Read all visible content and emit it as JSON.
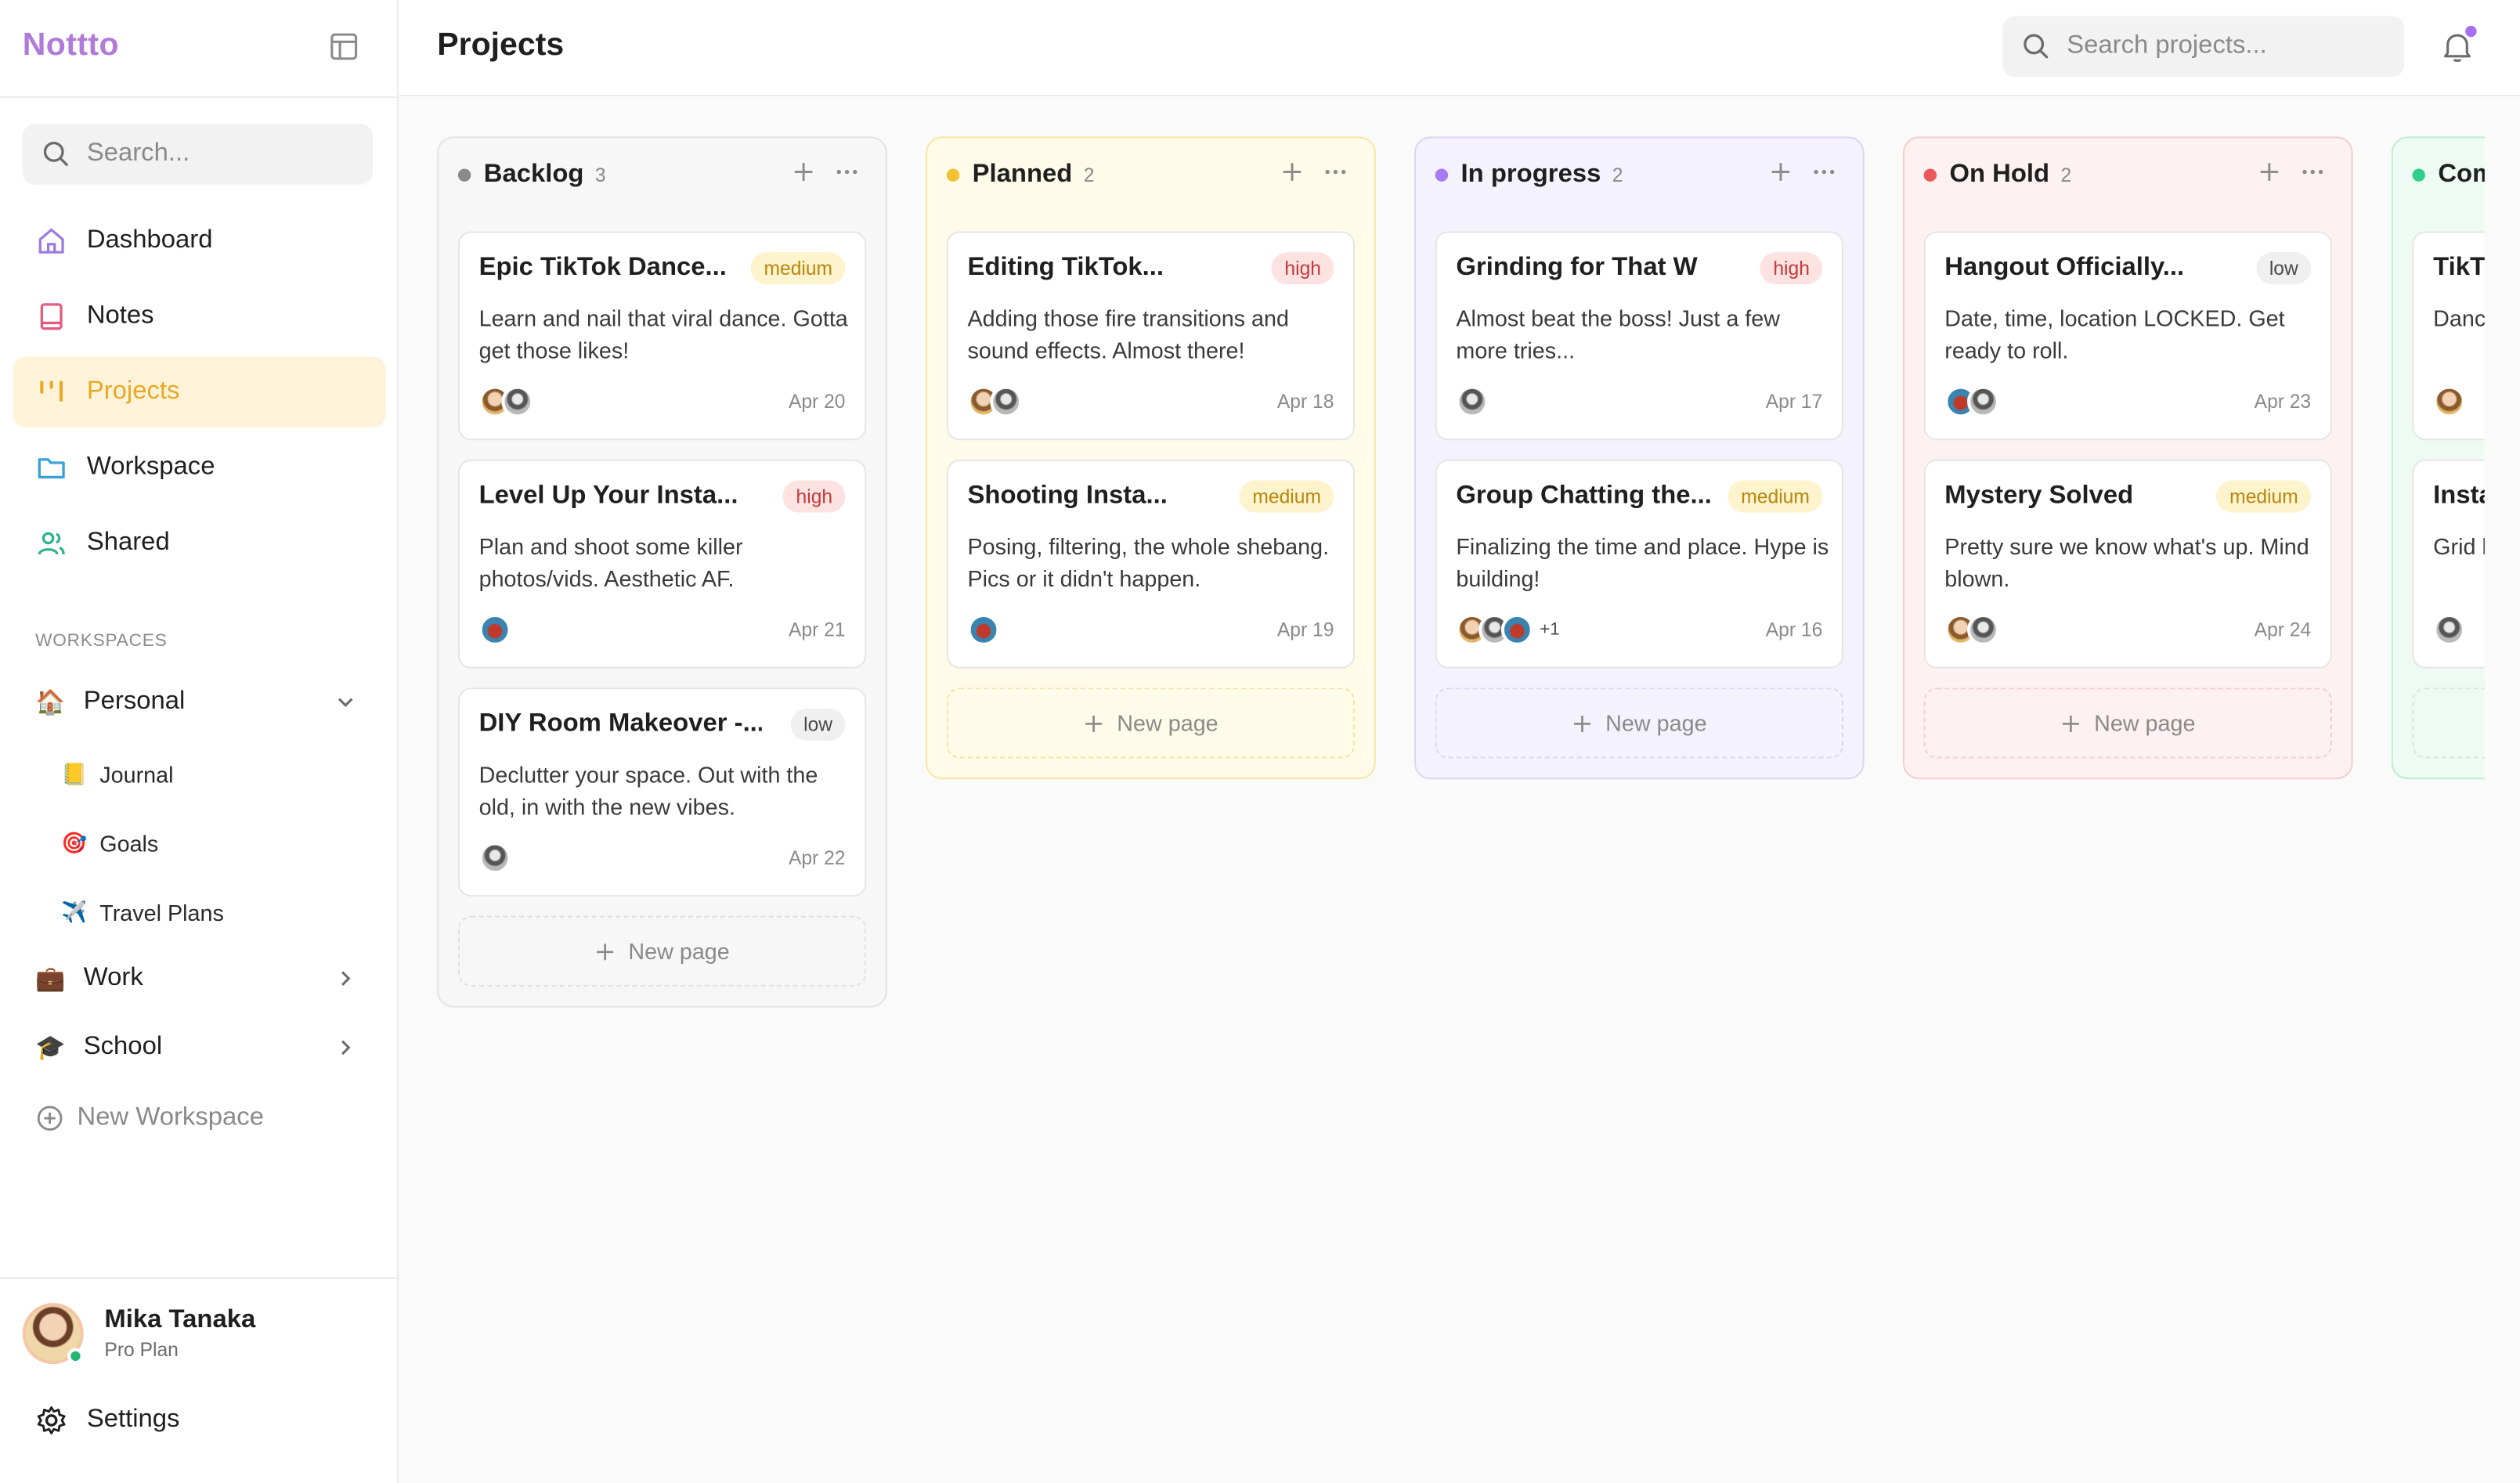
{
  "app": {
    "brand": "Nottto"
  },
  "sidebar": {
    "search_placeholder": "Search...",
    "nav": [
      {
        "label": "Dashboard",
        "icon": "home-icon",
        "active": false
      },
      {
        "label": "Notes",
        "icon": "notebook-icon",
        "active": false
      },
      {
        "label": "Projects",
        "icon": "kanban-icon",
        "active": true
      },
      {
        "label": "Workspace",
        "icon": "folder-icon",
        "active": false
      },
      {
        "label": "Shared",
        "icon": "users-icon",
        "active": false
      }
    ],
    "workspaces_heading": "WORKSPACES",
    "workspaces": [
      {
        "emoji": "🏠",
        "label": "Personal",
        "expanded": true,
        "children": [
          {
            "emoji": "📒",
            "label": "Journal"
          },
          {
            "emoji": "🎯",
            "label": "Goals"
          },
          {
            "emoji": "✈️",
            "label": "Travel Plans"
          }
        ]
      },
      {
        "emoji": "💼",
        "label": "Work",
        "expanded": false
      },
      {
        "emoji": "🎓",
        "label": "School",
        "expanded": false
      }
    ],
    "new_workspace": "New Workspace",
    "user": {
      "name": "Mika Tanaka",
      "plan": "Pro Plan",
      "status": "online"
    },
    "settings": "Settings"
  },
  "header": {
    "title": "Projects",
    "search_placeholder": "Search projects...",
    "has_notification": true
  },
  "board": {
    "new_page_label": "New page",
    "columns": [
      {
        "name": "Backlog",
        "count": "3",
        "color": "#8a8a8a",
        "cards": [
          {
            "title": "Epic TikTok Dance...",
            "priority": "medium",
            "desc": "Learn and nail that viral dance. Gotta get those likes!",
            "date": "Apr 20",
            "avatars": [
              "a",
              "b"
            ],
            "more": ""
          },
          {
            "title": "Level Up Your Insta...",
            "priority": "high",
            "desc": "Plan and shoot some killer photos/vids. Aesthetic AF.",
            "date": "Apr 21",
            "avatars": [
              "c"
            ],
            "more": ""
          },
          {
            "title": "DIY Room Makeover -...",
            "priority": "low",
            "desc": "Declutter your space. Out with the old, in with the new vibes.",
            "date": "Apr 22",
            "avatars": [
              "b"
            ],
            "more": ""
          }
        ]
      },
      {
        "name": "Planned",
        "count": "2",
        "color": "#f2c230",
        "cards": [
          {
            "title": "Editing TikTok...",
            "priority": "high",
            "desc": "Adding those fire transitions and sound effects. Almost there!",
            "date": "Apr 18",
            "avatars": [
              "a",
              "b"
            ],
            "more": ""
          },
          {
            "title": "Shooting Insta...",
            "priority": "medium",
            "desc": "Posing, filtering, the whole shebang. Pics or it didn't happen.",
            "date": "Apr 19",
            "avatars": [
              "c"
            ],
            "more": ""
          }
        ]
      },
      {
        "name": "In progress",
        "count": "2",
        "color": "#a67cf2",
        "cards": [
          {
            "title": "Grinding for That W",
            "priority": "high",
            "desc": "Almost beat the boss! Just a few more tries...",
            "date": "Apr 17",
            "avatars": [
              "b"
            ],
            "more": ""
          },
          {
            "title": "Group Chatting the...",
            "priority": "medium",
            "desc": "Finalizing the time and place. Hype is building!",
            "date": "Apr 16",
            "avatars": [
              "a",
              "b",
              "c"
            ],
            "more": "+1"
          }
        ]
      },
      {
        "name": "On Hold",
        "count": "2",
        "color": "#ea5a5a",
        "cards": [
          {
            "title": "Hangout Officially...",
            "priority": "low",
            "desc": "Date, time, location LOCKED. Get ready to roll.",
            "date": "Apr 23",
            "avatars": [
              "c",
              "b"
            ],
            "more": ""
          },
          {
            "title": "Mystery Solved",
            "priority": "medium",
            "desc": "Pretty sure we know what's up. Mind blown.",
            "date": "Apr 24",
            "avatars": [
              "a",
              "b"
            ],
            "more": ""
          }
        ]
      },
      {
        "name": "Com",
        "count": "",
        "color": "#2fcf8a",
        "cards": [
          {
            "title": "TikTo",
            "priority": "",
            "desc": "Danc views",
            "date": "",
            "avatars": [
              "a"
            ],
            "more": ""
          },
          {
            "title": "Insta",
            "priority": "",
            "desc": "Grid l DMs.",
            "date": "",
            "avatars": [
              "b"
            ],
            "more": ""
          }
        ]
      }
    ]
  }
}
